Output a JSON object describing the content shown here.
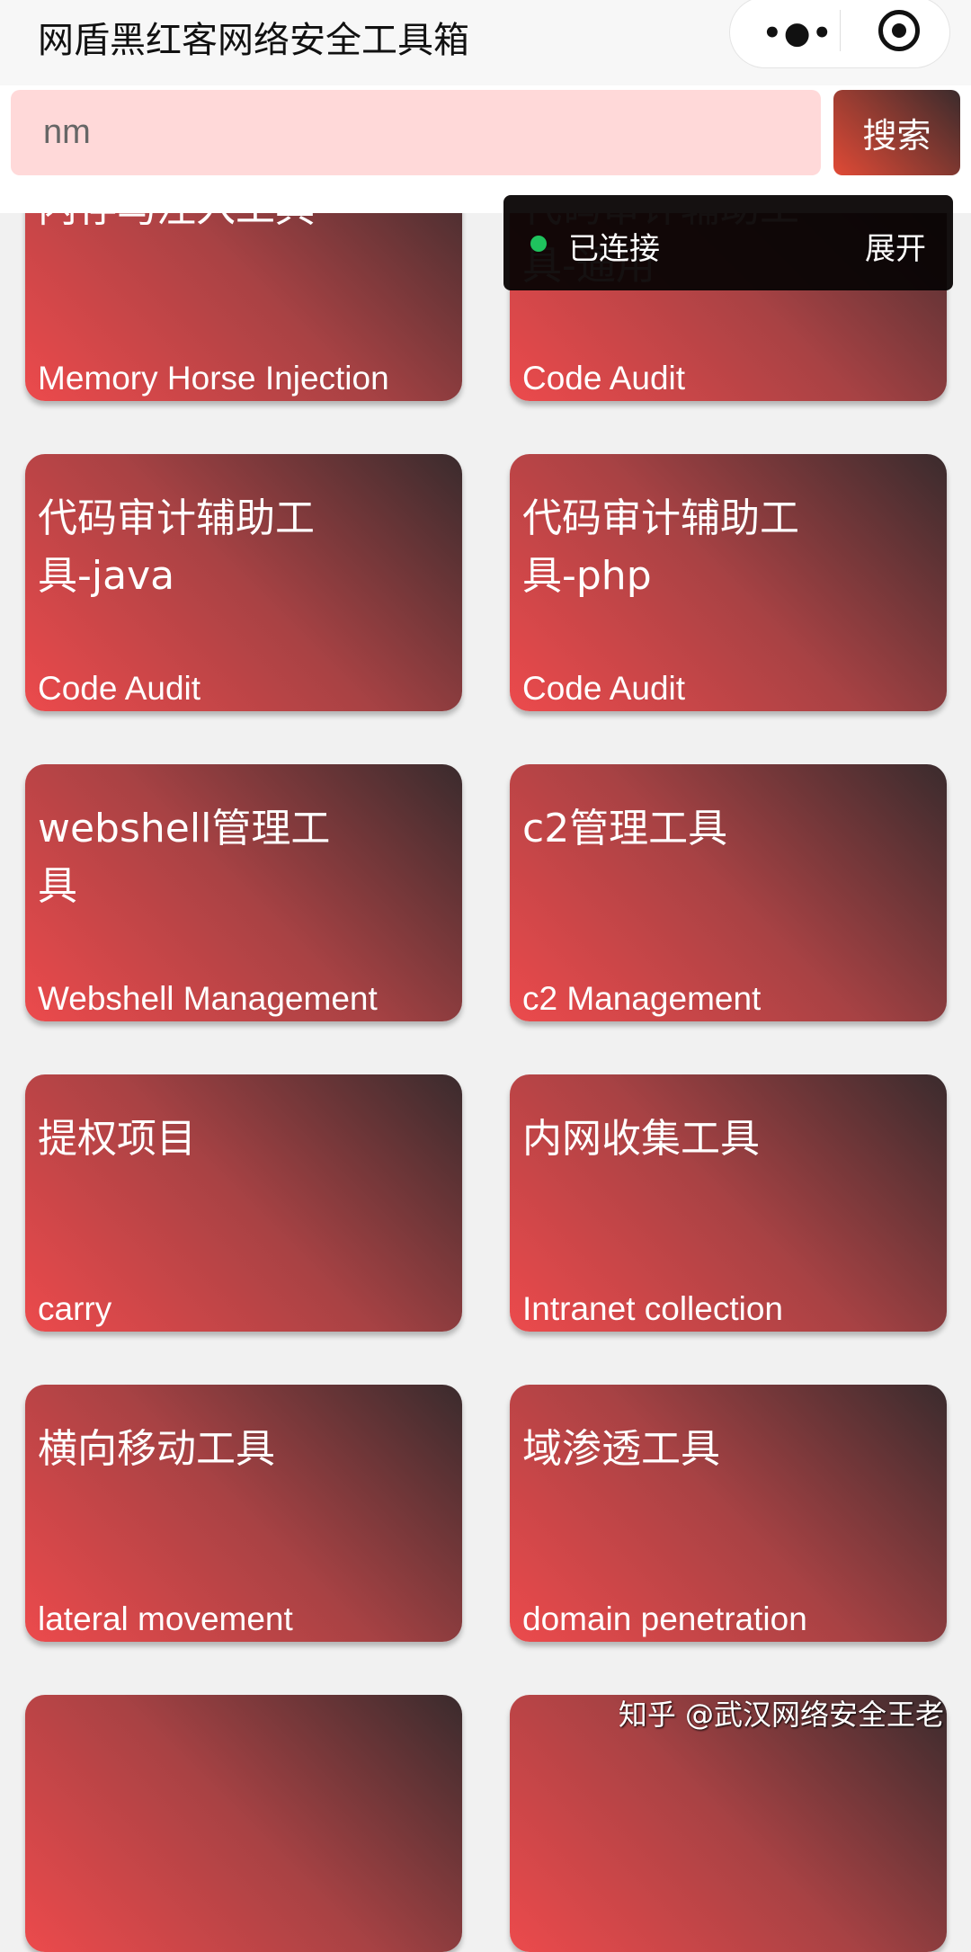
{
  "header": {
    "title": "网盾黑红客网络安全工具箱",
    "more_icon": "more-dots-icon",
    "target_icon": "record-target-icon"
  },
  "search": {
    "value": "nm",
    "button_label": "搜索"
  },
  "toast": {
    "status": "已连接",
    "status_color": "#1fc35e",
    "expand_label": "展开"
  },
  "cards": [
    {
      "title": "内存马注入工具",
      "subtitle": "Memory Horse Injection"
    },
    {
      "title": "代码审计辅助工具-通用",
      "subtitle": "Code Audit"
    },
    {
      "title": "代码审计辅助工具-java",
      "subtitle": "Code Audit"
    },
    {
      "title": "代码审计辅助工具-php",
      "subtitle": "Code Audit"
    },
    {
      "title": "webshell管理工具",
      "subtitle": "Webshell Management"
    },
    {
      "title": "c2管理工具",
      "subtitle": "c2 Management"
    },
    {
      "title": "提权项目",
      "subtitle": "carry"
    },
    {
      "title": "内网收集工具",
      "subtitle": "Intranet collection"
    },
    {
      "title": "横向移动工具",
      "subtitle": "lateral movement"
    },
    {
      "title": "域渗透工具",
      "subtitle": "domain penetration"
    },
    {
      "title": "",
      "subtitle": ""
    },
    {
      "title": "",
      "subtitle": ""
    }
  ],
  "watermark": "知乎 @武汉网络安全王老",
  "colors": {
    "card_gradient_start": "#ec4a4c",
    "card_gradient_end": "#3a2b2d",
    "search_bg": "#ffd9d9"
  }
}
